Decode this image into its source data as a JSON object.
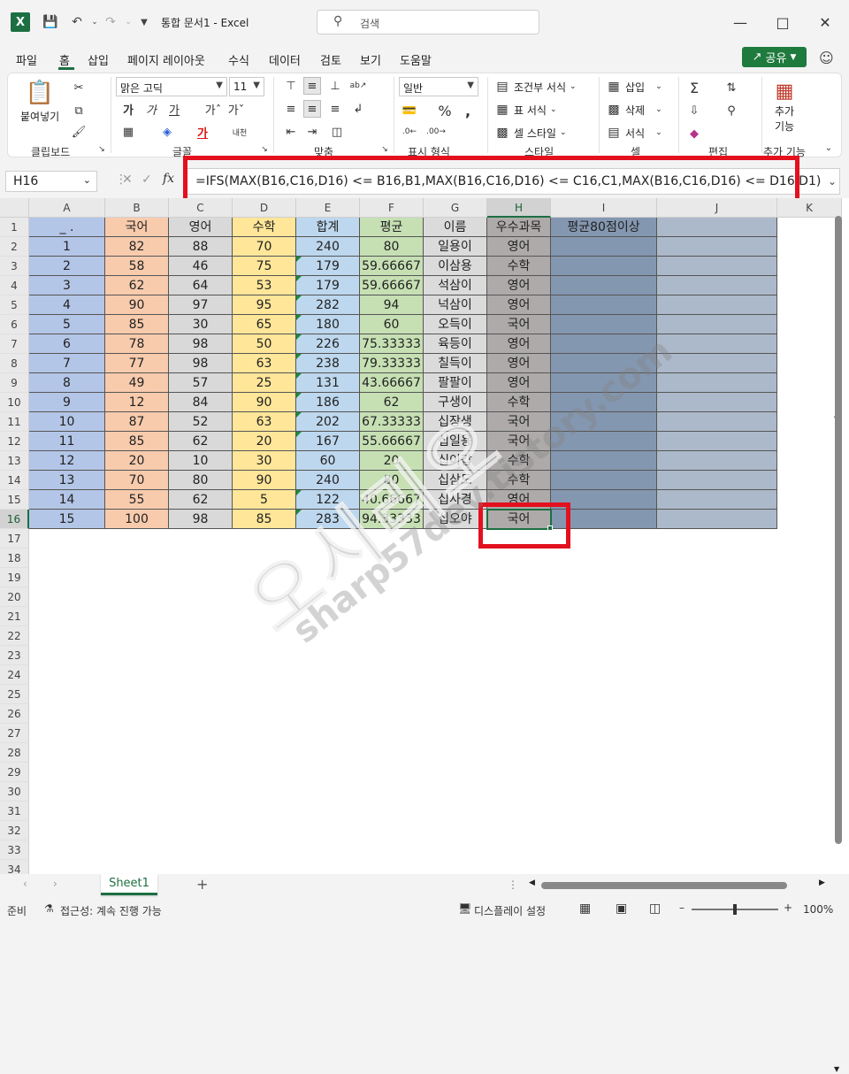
{
  "titlebar": {
    "app_logo": "X",
    "title": "통합 문서1  -  Excel",
    "search_placeholder": "검색"
  },
  "menu": {
    "items": [
      "파일",
      "홈",
      "삽입",
      "페이지 레이아웃",
      "수식",
      "데이터",
      "검토",
      "보기",
      "도움말"
    ],
    "share": "공유"
  },
  "ribbon": {
    "clipboard": {
      "paste": "붙여넣기",
      "label": "클립보드"
    },
    "font": {
      "name": "맑은 고딕",
      "size": "11",
      "label": "글꼴"
    },
    "align": {
      "label": "맞춤"
    },
    "number": {
      "format": "일반",
      "label": "표시 형식"
    },
    "styles": {
      "cond": "조건부 서식",
      "table": "표 서식",
      "cell": "셀 스타일",
      "label": "스타일"
    },
    "cells": {
      "insert": "삽입",
      "delete": "삭제",
      "format": "서식",
      "label": "셀"
    },
    "edit": {
      "label": "편집"
    },
    "addins": {
      "btn1": "추가",
      "btn2": "기능",
      "label": "추가 기능"
    }
  },
  "formula_bar": {
    "name_box": "H16",
    "formula": "=IFS(MAX(B16,C16,D16) <= B16,B1,MAX(B16,C16,D16) <= C16,C1,MAX(B16,C16,D16) <= D16,D1)"
  },
  "sheet": {
    "columns": [
      "A",
      "B",
      "C",
      "D",
      "E",
      "F",
      "G",
      "H",
      "I",
      "J",
      "K"
    ],
    "rows_visible": [
      "1",
      "2",
      "3",
      "4",
      "5",
      "6",
      "7",
      "8",
      "9",
      "10",
      "11",
      "12",
      "13",
      "14",
      "15",
      "16",
      "17",
      "18",
      "19",
      "20",
      "21",
      "22",
      "23",
      "24",
      "25",
      "26",
      "27",
      "28",
      "29",
      "30",
      "31",
      "32",
      "33",
      "34"
    ],
    "headers": [
      "_ .",
      "국어",
      "영어",
      "수학",
      "합계",
      "평균",
      "이름",
      "우수과목",
      "평균80점이상",
      ""
    ],
    "data": [
      [
        "1",
        "82",
        "88",
        "70",
        "240",
        "80",
        "일용이",
        "영어"
      ],
      [
        "2",
        "58",
        "46",
        "75",
        "179",
        "59.66667",
        "이삼용",
        "수학"
      ],
      [
        "3",
        "62",
        "64",
        "53",
        "179",
        "59.66667",
        "석삼이",
        "영어"
      ],
      [
        "4",
        "90",
        "97",
        "95",
        "282",
        "94",
        "넉삼이",
        "영어"
      ],
      [
        "5",
        "85",
        "30",
        "65",
        "180",
        "60",
        "오득이",
        "국어"
      ],
      [
        "6",
        "78",
        "98",
        "50",
        "226",
        "75.33333",
        "육등이",
        "영어"
      ],
      [
        "7",
        "77",
        "98",
        "63",
        "238",
        "79.33333",
        "칠득이",
        "영어"
      ],
      [
        "8",
        "49",
        "57",
        "25",
        "131",
        "43.66667",
        "팔팔이",
        "영어"
      ],
      [
        "9",
        "12",
        "84",
        "90",
        "186",
        "62",
        "구생이",
        "수학"
      ],
      [
        "10",
        "87",
        "52",
        "63",
        "202",
        "67.33333",
        "십장생",
        "국어"
      ],
      [
        "11",
        "85",
        "62",
        "20",
        "167",
        "55.66667",
        "십일용",
        "국어"
      ],
      [
        "12",
        "20",
        "10",
        "30",
        "60",
        "20",
        "십이갑",
        "수학"
      ],
      [
        "13",
        "70",
        "80",
        "90",
        "240",
        "80",
        "십삼도",
        "수학"
      ],
      [
        "14",
        "55",
        "62",
        "5",
        "122",
        "40.66667",
        "십사경",
        "영어"
      ],
      [
        "15",
        "100",
        "98",
        "85",
        "283",
        "94.33333",
        "십오야",
        "국어"
      ]
    ],
    "tab": "Sheet1"
  },
  "status": {
    "ready": "준비",
    "accessibility": "접근성: 계속 진행 가능",
    "display": "디스플레이 설정",
    "zoom": "100%"
  },
  "watermark": {
    "main": "오시리오",
    "sub": "sharp57dev.tistory.com"
  },
  "colors": {
    "colA": "#b4c6e7",
    "colB": "#f8cbad",
    "colC": "#d9d9d9",
    "colD": "#ffe699",
    "colE": "#bdd7ee",
    "colF": "#c6e0b4",
    "colG": "#dbdbdb",
    "colH": "#aeaaaa",
    "colI": "#8497b0",
    "colJ": "#acb9ca",
    "accent": "#1d6f42",
    "highlight": "#e3101e"
  }
}
